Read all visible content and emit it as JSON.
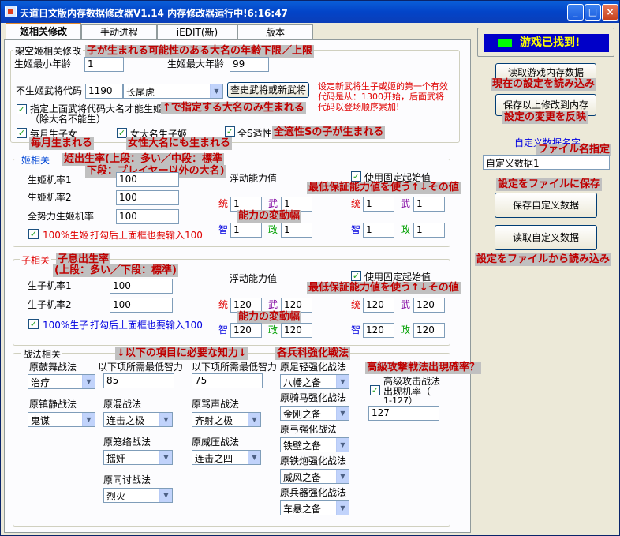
{
  "window": {
    "title": "天道日文版内存数据修改器V1.14  内存修改器运行中!6:16:47"
  },
  "tabs": [
    "姬相关修改",
    "手动进程",
    "iEDIT(新)",
    "版本"
  ],
  "top": {
    "group_label": "架空姬相关修改",
    "ann_age": "子が生まれる可能性のある大名の年齢下限／上限",
    "min_age_label": "生姬最小年龄",
    "min_age": "1",
    "max_age_label": "生姬最大年龄",
    "max_age": "99",
    "exclude_label": "不生姬武将代码",
    "exclude_code": "1190",
    "exclude_name": "长尾虎",
    "lookup_btn": "查史武将或新武将",
    "hint": "设定新武将生子或姬的第一个有效代码是从：1300开始，后面武将代码以登场顺序累加!",
    "only_label_1": "指定上面武将代码大名才能生姬",
    "only_label_2": "（除大名不能生）",
    "ann_only": "↑で指定する大名のみ生まれる",
    "monthly_label": "每月生子女",
    "ann_monthly": "毎月生まれる",
    "female_label": "女大名生子姬",
    "ann_female": "女性大名にも生まれる",
    "s_label": "全S适性",
    "ann_s": "全適性Sの子が生まれる"
  },
  "hime": {
    "group_label": "姬相关",
    "ann_rate_1": "姫出生率(上段：多い／中段：標準",
    "ann_rate_2": "下段：プレイヤー以外の大名)",
    "rate1_label": "生姬机率1",
    "rate1": "100",
    "rate2_label": "生姬机率2",
    "rate2": "100",
    "rate3_label": "全势力生姬机率",
    "rate3": "100",
    "check100_label": "100%生姬",
    "check100_note": "打勾后上面框也要输入100",
    "float_label": "浮动能力值",
    "ann_float": "能力の変動幅",
    "fixed_label": "使用固定起始值",
    "ann_fixed": "最低保証能力値を使う↑↓その値",
    "float_vals": {
      "tong": "1",
      "wu": "1",
      "zhi": "1",
      "zheng": "1"
    },
    "fixed_vals": {
      "tong": "1",
      "wu": "1",
      "zhi": "1",
      "zheng": "1"
    }
  },
  "child": {
    "group_label": "子相关",
    "ann_rate_1": "子息出生率",
    "ann_rate_2": "(上段：多い／下段：標準)",
    "rate1_label": "生子机率1",
    "rate1": "100",
    "rate2_label": "生子机率2",
    "rate2": "100",
    "check100_label": "100%生子",
    "check100_note": "打勾后上面框也要输入100",
    "float_label": "浮动能力值",
    "ann_float": "能力の変動幅",
    "fixed_label": "使用固定起始值",
    "ann_fixed": "最低保証能力値を使う↑↓その値",
    "float_vals": {
      "tong": "120",
      "wu": "120",
      "zhi": "120",
      "zheng": "120"
    },
    "fixed_vals": {
      "tong": "120",
      "wu": "120",
      "zhi": "120",
      "zheng": "120"
    }
  },
  "stats": {
    "tong": "统",
    "wu": "武",
    "zhi": "智",
    "zheng": "政"
  },
  "tactics": {
    "group_label": "战法相关",
    "ann_intel": "↓以下の項目に必要な知力↓",
    "ann_branch": "各兵科強化戦法",
    "ann_adv": "高級攻撃戦法出現確率？",
    "guwu_label": "原鼓舞战法",
    "guwu": "治疗",
    "minint1_label": "以下项所需最低智力",
    "minint1": "85",
    "minint2_label": "以下项所需最低智力",
    "minint2": "75",
    "zhenjing_label": "原镇静战法",
    "zhenjing": "鬼谋",
    "hunluan_label": "原混战法",
    "hunluan": "连击之极",
    "mashen_label": "原骂声战法",
    "mashen": "齐射之极",
    "longluo_label": "原笼络战法",
    "longluo": "揺奸",
    "weiya_label": "原威压战法",
    "weiya": "连击之四",
    "tongtao_label": "原同讨战法",
    "tongtao": "烈火",
    "zuqing_label": "原足轻强化战法",
    "zuqing": "八幡之备",
    "qima_label": "原骑马强化战法",
    "qima": "金刚之备",
    "gong_label": "原弓强化战法",
    "gong": "铁壁之备",
    "tiepao_label": "原铁炮强化战法",
    "tiepao": "威风之备",
    "bingqi_label": "原兵器强化战法",
    "bingqi": "车悬之备",
    "adv_label_1": "高级攻击战法",
    "adv_label_2": "出现机率（",
    "adv_label_3": "1-127）",
    "adv_value": "127"
  },
  "right": {
    "found": "游戏已找到!",
    "read_btn": "读取游戏内存数据",
    "ann_read": "現在の設定を読み込み",
    "save_mem_btn": "保存以上修改到内存",
    "ann_save_mem": "設定の変更を反映",
    "name_label": "自定义数据名字",
    "ann_name": "ファイル名指定",
    "name_value": "自定义数据1",
    "ann_save_file": "設定をファイルに保存",
    "save_file_btn": "保存自定义数据",
    "load_file_btn": "读取自定义数据",
    "ann_load_file": "設定をファイルから読み込み"
  },
  "colors": {
    "annotation_bg": "#c0c0c0",
    "annotation_fg": "#c00000",
    "found_bg": "#0000c8",
    "found_fg": "#ffff00"
  }
}
